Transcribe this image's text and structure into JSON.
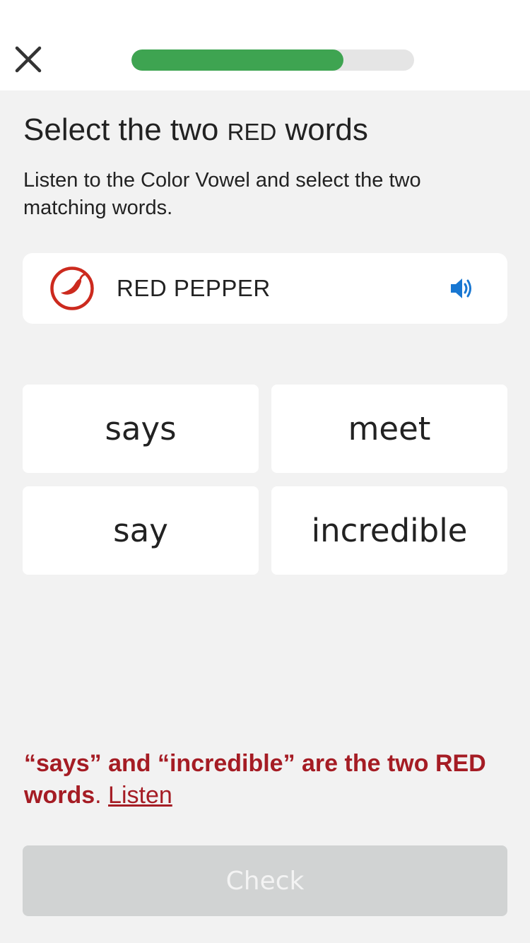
{
  "header": {
    "close_icon": "close-icon",
    "progress": 0.75,
    "progress_color": "#3ea451",
    "progress_track_color": "#e5e5e5"
  },
  "prompt": {
    "title_before": "Select the two ",
    "title_color_word": "RED",
    "title_after": " words",
    "subtitle": "Listen to the Color Vowel and select the two matching words."
  },
  "vowel_card": {
    "icon": "red-pepper-icon",
    "label": "RED PEPPER",
    "audio_icon": "speaker-icon",
    "accent_color": "#cc2a1e",
    "audio_color": "#1877d2"
  },
  "words": [
    {
      "label": "says"
    },
    {
      "label": "meet"
    },
    {
      "label": "say"
    },
    {
      "label": "incredible"
    }
  ],
  "feedback": {
    "message": "“says” and “incredible” are the two RED words",
    "period": ".",
    "link_label": "Listen",
    "color": "#a51c24"
  },
  "footer": {
    "check_label": "Check",
    "check_bg": "#d1d3d3"
  }
}
